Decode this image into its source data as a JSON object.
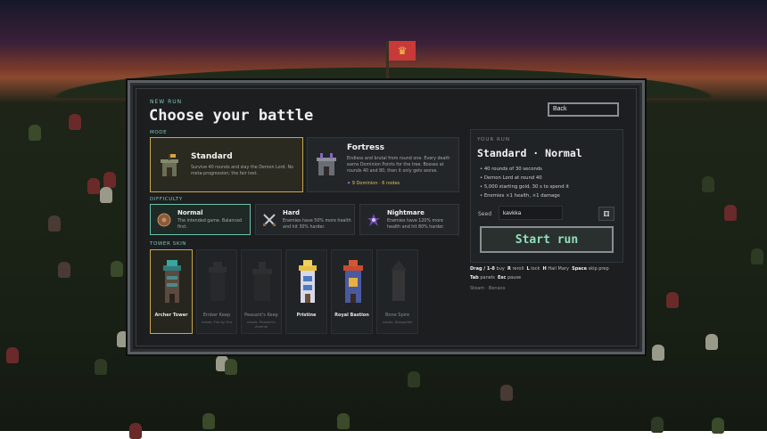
{
  "header": {
    "kicker": "NEW RUN",
    "title": "Choose your battle"
  },
  "sections": {
    "mode": "MODE",
    "difficulty": "DIFFICULTY",
    "tower_skin": "TOWER SKIN"
  },
  "modes": [
    {
      "title": "Standard",
      "desc": "Survive 40 rounds and slay the Demon Lord. No meta-progression; the fair test.",
      "selected": true
    },
    {
      "title": "Fortress",
      "desc": "Endless and brutal from round one. Every death earns Dominion Points for the tree. Bosses at rounds 40 and 80, then it only gets worse.",
      "meta": "9 Dominion · 6 nodes",
      "selected": false
    }
  ],
  "difficulties": [
    {
      "title": "Normal",
      "desc": "The intended game. Balanced first.",
      "selected": true
    },
    {
      "title": "Hard",
      "desc": "Enemies have 50% more health and hit 30% harder.",
      "selected": false
    },
    {
      "title": "Nightmare",
      "desc": "Enemies have 120% more health and hit 80% harder.",
      "selected": false
    }
  ],
  "towers": [
    {
      "name": "Archer Tower",
      "sub": "",
      "locked": false,
      "selected": true
    },
    {
      "name": "Ember Keep",
      "sub": "needs: Fist by Fire",
      "locked": true,
      "selected": false
    },
    {
      "name": "Peasant's Keep",
      "sub": "needs: Peasant's Arsenal",
      "locked": true,
      "selected": false
    },
    {
      "name": "Pristine",
      "sub": "",
      "locked": false,
      "selected": false
    },
    {
      "name": "Royal Bastion",
      "sub": "",
      "locked": false,
      "selected": false
    },
    {
      "name": "Bone Spire",
      "sub": "needs: Dragonfall",
      "locked": true,
      "selected": false
    }
  ],
  "run": {
    "back_label": "Back",
    "kicker": "YOUR RUN",
    "summary": "Standard · Normal",
    "bullets": [
      "40 rounds of 30 seconds",
      "Demon Lord at round 40",
      "5,000 starting gold, 30 s to spend it",
      "Enemies ×1 health, ×1 damage"
    ],
    "seed_label": "Seed",
    "seed_value": "kavkka",
    "start_label": "Start run"
  },
  "hints": {
    "line1": [
      {
        "key": "Drag / 1-8",
        "text": "buy"
      },
      {
        "key": "R",
        "text": "reroll"
      },
      {
        "key": "L",
        "text": "lock"
      },
      {
        "key": "H",
        "text": "Hail Mary"
      },
      {
        "key": "Space",
        "text": "skip prep"
      }
    ],
    "line2": [
      {
        "key": "Tab",
        "text": "panels"
      },
      {
        "key": "Esc",
        "text": "pause"
      }
    ],
    "footer": "Steam · Benaco"
  },
  "colors": {
    "accent_teal": "#7cc9b5",
    "gold_border": "#c9a74a",
    "flag_red": "#c83a38"
  }
}
